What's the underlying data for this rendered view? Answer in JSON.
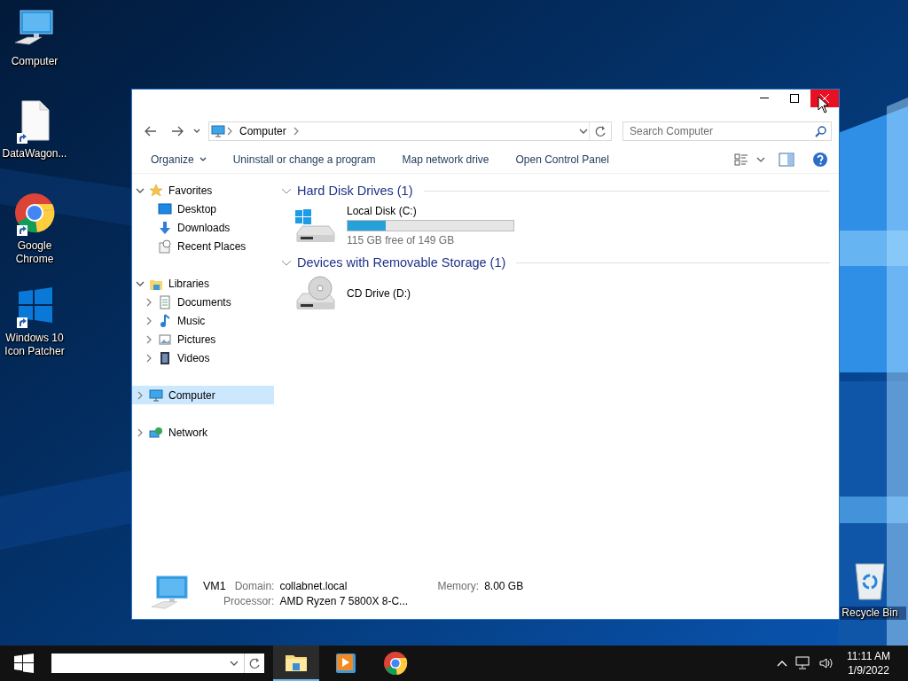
{
  "desktop_icons": [
    {
      "label": "Computer",
      "kind": "computer",
      "shortcut": false
    },
    {
      "label": "DataWagon...",
      "kind": "file",
      "shortcut": true
    },
    {
      "label": "Google Chrome",
      "kind": "chrome",
      "shortcut": true
    },
    {
      "label": "Windows 10 Icon Patcher",
      "kind": "windows",
      "shortcut": true
    }
  ],
  "recycle_bin": {
    "label": "Recycle Bin",
    "kind": "recycle",
    "shortcut": false
  },
  "window": {
    "caption_buttons": [
      {
        "kind": "minimize",
        "hovered": false
      },
      {
        "kind": "maximize",
        "hovered": false
      },
      {
        "kind": "close",
        "hovered": true
      }
    ],
    "address": {
      "crumbs": [
        "Computer"
      ]
    },
    "search": {
      "placeholder": "Search Computer"
    },
    "toolbar": [
      {
        "label": "Organize",
        "menu": true
      },
      {
        "label": "Uninstall or change a program",
        "menu": false
      },
      {
        "label": "Map network drive",
        "menu": false
      },
      {
        "label": "Open Control Panel",
        "menu": false
      }
    ],
    "nav": [
      {
        "label": "Favorites",
        "kind": "star",
        "expanded": true,
        "selected": false,
        "children": [
          {
            "label": "Desktop",
            "kind": "desktop",
            "selected": false
          },
          {
            "label": "Downloads",
            "kind": "downloads",
            "selected": false
          },
          {
            "label": "Recent Places",
            "kind": "recent",
            "selected": false
          }
        ]
      },
      {
        "label": "Libraries",
        "kind": "library",
        "expanded": true,
        "selected": false,
        "children": [
          {
            "label": "Documents",
            "kind": "documents",
            "expanded": false,
            "selected": false
          },
          {
            "label": "Music",
            "kind": "music",
            "expanded": false,
            "selected": false
          },
          {
            "label": "Pictures",
            "kind": "pictures",
            "expanded": false,
            "selected": false
          },
          {
            "label": "Videos",
            "kind": "videos",
            "expanded": false,
            "selected": false
          }
        ]
      },
      {
        "label": "Computer",
        "kind": "computer",
        "expanded": false,
        "selected": true
      },
      {
        "label": "Network",
        "kind": "network",
        "expanded": false,
        "selected": false
      }
    ],
    "sections": [
      {
        "title": "Hard Disk Drives (1)",
        "expanded": true,
        "items": [
          {
            "name": "Local Disk (C:)",
            "kind": "hdd",
            "level": 0.23,
            "free": "115 GB free of 149 GB"
          }
        ]
      },
      {
        "title": "Devices with Removable Storage (1)",
        "expanded": true,
        "items": [
          {
            "name": "CD Drive (D:)",
            "kind": "cd"
          }
        ]
      }
    ],
    "details": {
      "name": "VM1",
      "fields": [
        {
          "label": "Domain:",
          "value": "collabnet.local"
        },
        {
          "label": "Memory:",
          "value": "8.00 GB"
        },
        {
          "label": "Processor:",
          "value": "AMD Ryzen 7 5800X 8-C..."
        }
      ]
    }
  },
  "taskbar": {
    "apps": [
      {
        "kind": "explorer",
        "active": true
      },
      {
        "kind": "media",
        "active": false
      },
      {
        "kind": "chrome",
        "active": false
      }
    ],
    "time": "11:11 AM",
    "date": "1/9/2022"
  }
}
